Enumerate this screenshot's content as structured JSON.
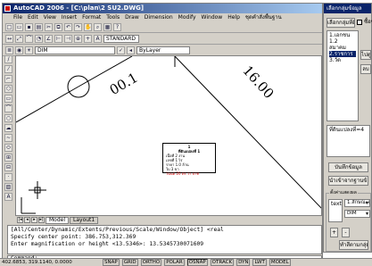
{
  "acad": {
    "title": "AutoCAD 2006 - [C:\\plan\\2 SU2.DWG]",
    "menu": [
      "File",
      "Edit",
      "View",
      "Insert",
      "Format",
      "Tools",
      "Draw",
      "Dimension",
      "Modify",
      "Window",
      "Help",
      "ชุดคำสั่งพื้นฐาน"
    ],
    "style_combo": "STANDARD",
    "layer_combo": "DIM",
    "linetype_combo": "ByLayer",
    "dim_labels": [
      "00.1",
      "16.00"
    ],
    "info_box": {
      "number": "1",
      "title": "ที่ดินแปลงที่ 1",
      "rows": [
        "เนื้อที่ 2 งาน",
        "เลขที่ 1 ไร่",
        "ราคา 1.0 ล้าน",
        "ใบ 3 ขา",
        "โฉนด 20 ตร.วา.บาท"
      ]
    },
    "tabs": [
      "Model",
      "Layout1"
    ],
    "command_lines": [
      "[All/Center/Dynamic/Extents/Previous/Scale/Window/Object] <real",
      "Specify center point: 386.753,312.369",
      "Enter magnification or height <13.5346>: 13.5345730071609"
    ],
    "command_prompt": "Command:",
    "status": {
      "coords": "402.6853, 319.1140, 0.0000",
      "buttons": [
        "SNAP",
        "GRID",
        "ORTHO",
        "POLAR",
        "OSNAP",
        "OTRACK",
        "DYN",
        "LWT",
        "MODEL"
      ]
    }
  },
  "dialog": {
    "title": "เลือกกลุ่มข้อมูล",
    "top_button": "เลือกกลุ่มที่ดิน",
    "checkbox_label": "ซื้อขาย",
    "list_items": [
      "1.เอกชน",
      "1.2 สมาคม",
      "2.ราชการ",
      "3.วัด"
    ],
    "selected_index": 2,
    "side_buttons": [
      "ไปดู",
      "ลบ"
    ],
    "text_area": "ที่ดินแปลงที่=4",
    "button_save": "บันทึกข้อมูล",
    "button_import": "นำเข้าจากฐานข้อมูล",
    "group_label": "ตั้งค่าแสดงผล",
    "group_list": [
      "text.txt"
    ],
    "group_combo1": "1.ลักษณะแปลง",
    "group_combo2": "DIM",
    "btn_plus": "+",
    "btn_minus": "-",
    "btn_apply": "ทำสีตามกลุ่ม"
  },
  "colors": {
    "titlebar": "#0a246a",
    "accent_red": "#cc0000",
    "canvas": "#ffffff"
  },
  "icons": [
    "acad-logo-icon",
    "crosshair-icon",
    "ucs-icon"
  ]
}
